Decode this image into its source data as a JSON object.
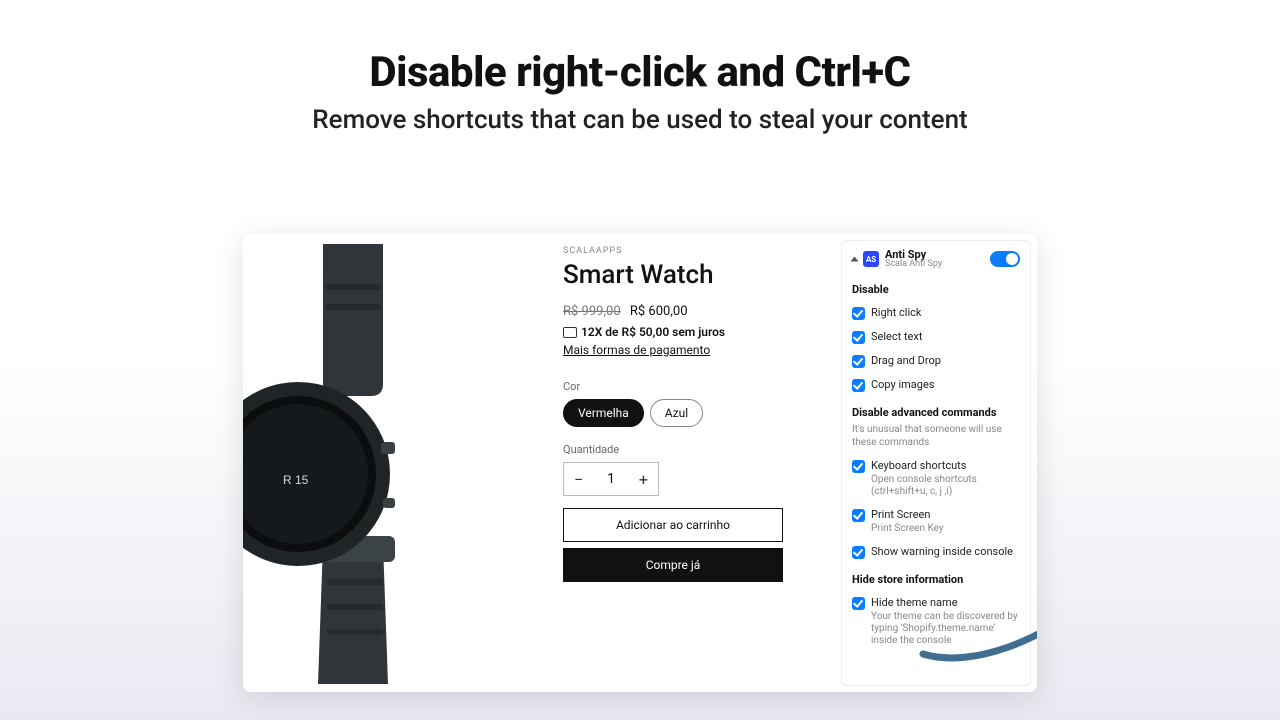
{
  "hero": {
    "title": "Disable right-click and Ctrl+C",
    "subtitle": "Remove shortcuts that can be used to steal your content"
  },
  "product": {
    "vendor": "SCALAAPPS",
    "title": "Smart Watch",
    "price_old": "R$ 999,00",
    "price_new": "R$ 600,00",
    "installments": "12X de R$ 50,00 sem juros",
    "more_payments": "Mais formas de pagamento",
    "option_label": "Cor",
    "option_values": {
      "selected": "Vermelha",
      "other": "Azul"
    },
    "qty_label": "Quantidade",
    "qty_value": "1",
    "add_to_cart": "Adicionar ao carrinho",
    "buy_now": "Compre já"
  },
  "panel": {
    "app_name": "Anti Spy",
    "app_sub": "Scala Anti Spy",
    "section_disable": "Disable",
    "items_basic": {
      "right_click": "Right click",
      "select_text": "Select text",
      "drag_drop": "Drag and Drop",
      "copy_images": "Copy images"
    },
    "section_advanced": "Disable advanced commands",
    "advanced_note": "It's unusual that someone will use these commands",
    "items_advanced": {
      "kbd": {
        "label": "Keyboard shortcuts",
        "sub": "Open console shortcuts (ctrl+shift+u, c, j ,i)"
      },
      "print": {
        "label": "Print Screen",
        "sub": "Print Screen Key"
      },
      "warn": {
        "label": "Show warning inside console"
      }
    },
    "section_hide": "Hide store information",
    "items_hide": {
      "theme": {
        "label": "Hide theme name",
        "sub": "Your theme can be discovered by typing 'Shopify.theme.name' inside the console"
      }
    }
  }
}
